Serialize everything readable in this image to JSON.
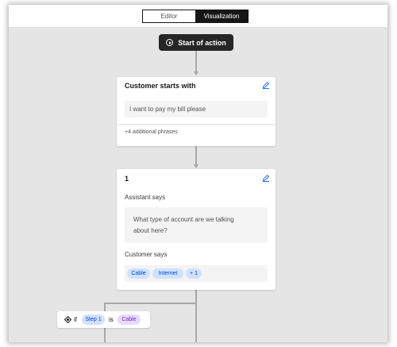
{
  "tabs": {
    "editor": "Editor",
    "visualization": "Visualization"
  },
  "start": {
    "label": "Start of action"
  },
  "customer_card": {
    "title": "Customer starts with",
    "phrase": "I want to pay my bill please",
    "more": "+4 additional phrases"
  },
  "step_card": {
    "title": "1",
    "assistant_label": "Assistant says",
    "assistant_text_line1": "What type of account are we talking",
    "assistant_text_line2": "about here?",
    "customer_label": "Customer says",
    "options": [
      "Cable",
      "Internet",
      "+ 1"
    ]
  },
  "condition": {
    "if": "if",
    "step": "Step 1",
    "is": "is",
    "value": "Cable"
  },
  "colors": {
    "accent": "#0f62fe",
    "tag_blue_bg": "#d0e2ff",
    "tag_purple_bg": "#e8daff",
    "canvas": "#e5e5e5"
  }
}
